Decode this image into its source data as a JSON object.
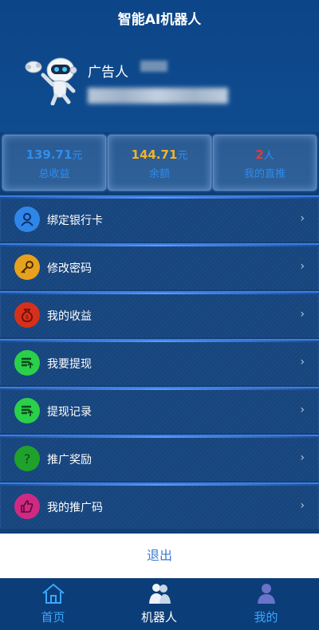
{
  "app": {
    "title": "智能AI机器人"
  },
  "user": {
    "name": "广告人"
  },
  "stats": [
    {
      "value": "139.71",
      "unit": "元",
      "label": "总收益",
      "color": "#2f8ef0"
    },
    {
      "value": "144.71",
      "unit": "元",
      "label": "余额",
      "color": "#f0b428"
    },
    {
      "value": "2",
      "unit": "人",
      "label": "我的直推",
      "color": "#e23a3a"
    }
  ],
  "menu": [
    {
      "label": "绑定银行卡",
      "icon": "user-icon",
      "icon_bg": "#2f86e8",
      "arrow": "›"
    },
    {
      "label": "修改密码",
      "icon": "key-icon",
      "icon_bg": "#e6a21e",
      "arrow": "›"
    },
    {
      "label": "我的收益",
      "icon": "money-bag-icon",
      "icon_bg": "#d6301d",
      "arrow": "›"
    },
    {
      "label": "我要提现",
      "icon": "withdraw-icon",
      "icon_bg": "#2ad04a",
      "arrow": "›"
    },
    {
      "label": "提现记录",
      "icon": "withdraw-record-icon",
      "icon_bg": "#2ad04a",
      "arrow": "›"
    },
    {
      "label": "推广奖励",
      "icon": "question-icon",
      "icon_bg": "#1fa12c",
      "arrow": "›"
    },
    {
      "label": "我的推广码",
      "icon": "thumbs-up-icon",
      "icon_bg": "#cf2a83",
      "arrow": "›"
    }
  ],
  "logout": {
    "label": "退出"
  },
  "tabbar": [
    {
      "label": "首页",
      "icon": "home-icon",
      "color": "#3aa8ff"
    },
    {
      "label": "机器人",
      "icon": "robot-tab-icon",
      "color": "#ffffff"
    },
    {
      "label": "我的",
      "icon": "profile-icon",
      "color": "#3aa8ff"
    }
  ]
}
